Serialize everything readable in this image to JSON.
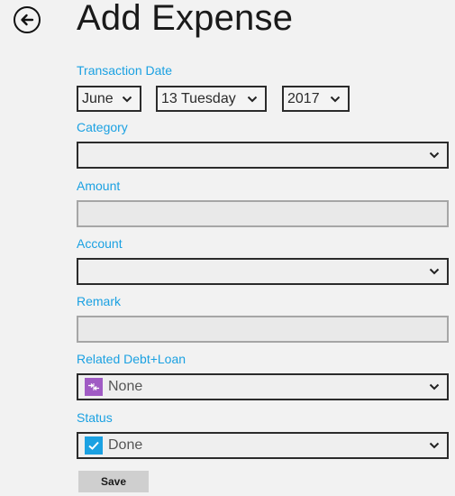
{
  "header": {
    "title": "Add Expense"
  },
  "transaction_date": {
    "label": "Transaction Date",
    "month": "June",
    "day": "13 Tuesday",
    "year": "2017"
  },
  "category": {
    "label": "Category",
    "value": ""
  },
  "amount": {
    "label": "Amount",
    "value": ""
  },
  "account": {
    "label": "Account",
    "value": ""
  },
  "remark": {
    "label": "Remark",
    "value": ""
  },
  "related_debt_loan": {
    "label": "Related Debt+Loan",
    "value": "None",
    "icon": "debt-loan-icon",
    "icon_color": "#a05bc4"
  },
  "status": {
    "label": "Status",
    "value": "Done",
    "icon": "checkmark-icon",
    "icon_color": "#1ba1e2"
  },
  "actions": {
    "save_label": "Save"
  },
  "theme": {
    "accent": "#1ba1e2",
    "background": "#f2f2f2"
  }
}
